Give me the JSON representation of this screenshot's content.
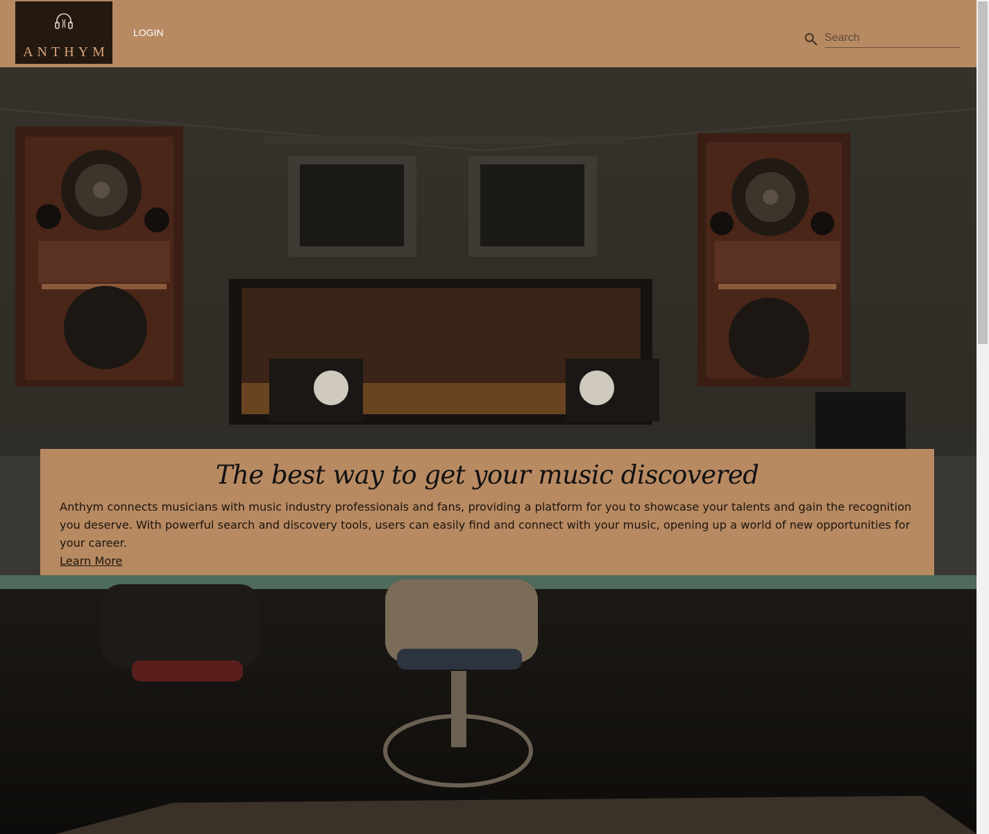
{
  "header": {
    "logo_text": "ANTHYM",
    "nav": {
      "login_label": "LOGIN"
    },
    "search": {
      "placeholder": "Search",
      "value": ""
    }
  },
  "hero": {
    "title": "The best way to get your music discovered",
    "body": "Anthym connects musicians with music industry professionals and fans, providing a platform for you to showcase your talents and gain the recognition you deserve. With powerful search and discovery tools, users can easily find and connect with your music, opening up a world of new opportunities for your career.",
    "link_label": "Learn More"
  },
  "colors": {
    "header_bg": "#b88a62",
    "logo_bg": "#24190f",
    "logo_text": "#d9a47a",
    "card_bg": "#b88a62"
  },
  "icons": [
    "headphones-icon",
    "search-icon"
  ]
}
